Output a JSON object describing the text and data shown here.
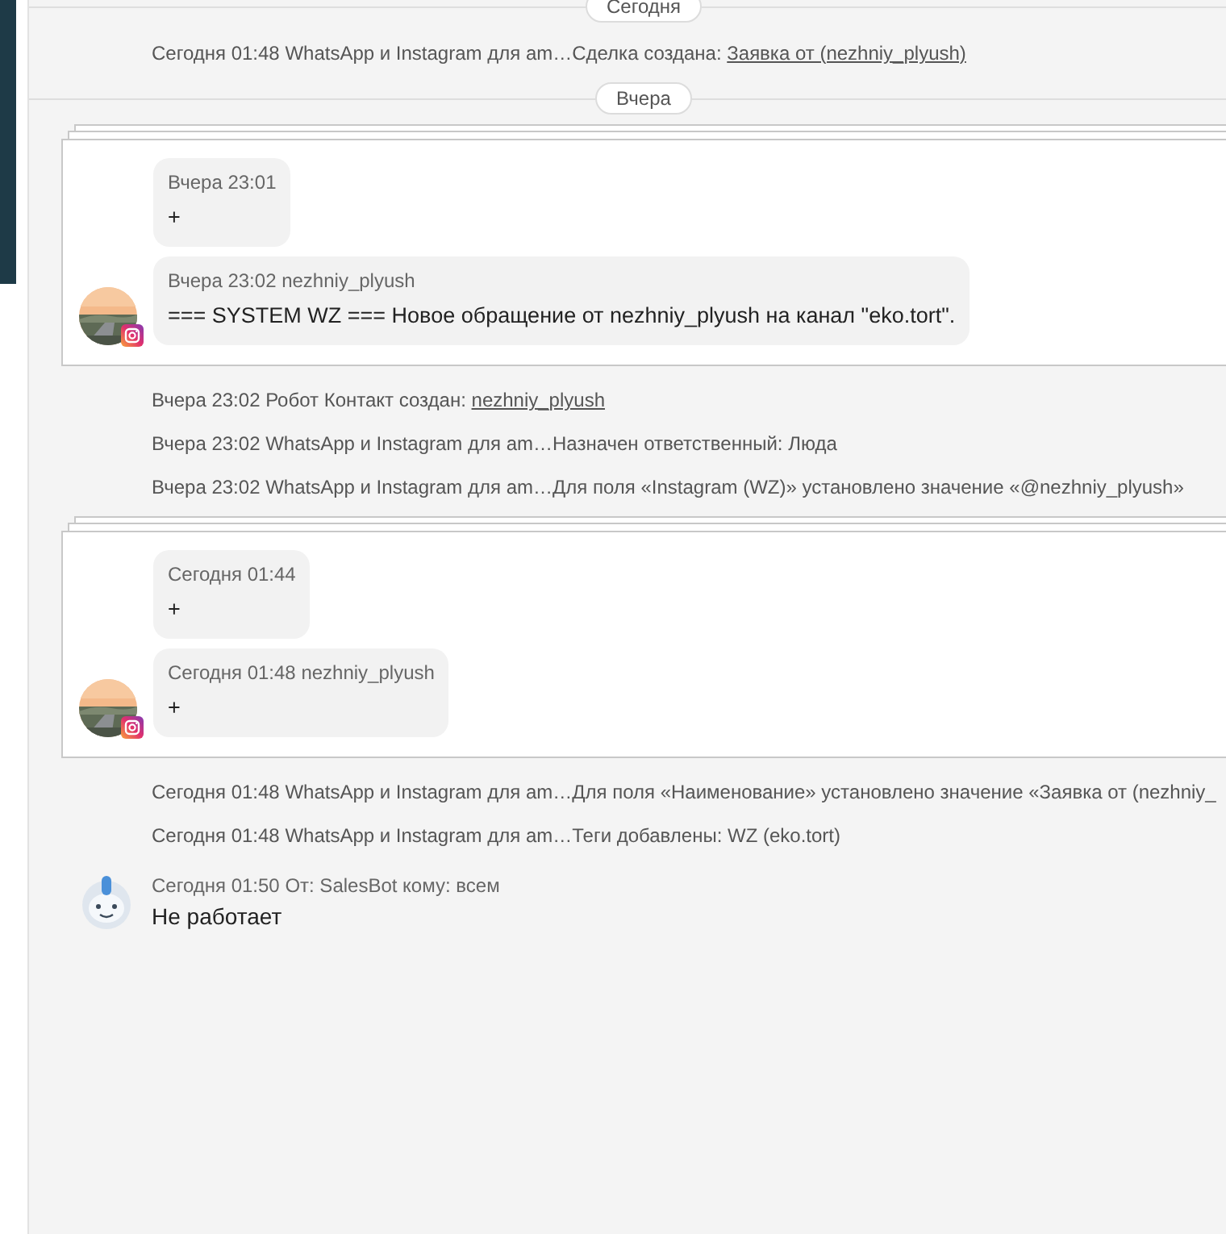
{
  "feed": [
    {
      "kind": "divider",
      "label": "Сегодня"
    },
    {
      "kind": "event",
      "time": "Сегодня 01:48",
      "source": "WhatsApp и Instagram для am…",
      "text": "Сделка создана: ",
      "link": "Заявка от (nezhniy_plyush)"
    },
    {
      "kind": "divider",
      "label": "Вчера"
    },
    {
      "kind": "chat",
      "messages": [
        {
          "header": "Вчера 23:01",
          "body": "+",
          "avatar": false
        },
        {
          "header": "Вчера 23:02 nezhniy_plyush",
          "body": "=== SYSTEM WZ === Новое обращение от nezhniy_plyush на канал \"eko.tort\".",
          "avatar": true
        }
      ]
    },
    {
      "kind": "event",
      "time": "Вчера 23:02",
      "source": "Робот ",
      "text": " Контакт создан: ",
      "link": "nezhniy_plyush"
    },
    {
      "kind": "event",
      "time": "Вчера 23:02",
      "source": "WhatsApp и Instagram для am…",
      "text": "Назначен ответственный: Люда"
    },
    {
      "kind": "event",
      "time": "Вчера 23:02",
      "source": "WhatsApp и Instagram для am…",
      "text": "Для поля «Instagram (WZ)» установлено значение «@nezhniy_plyush»"
    },
    {
      "kind": "chat",
      "messages": [
        {
          "header": "Сегодня 01:44",
          "body": "+",
          "avatar": false
        },
        {
          "header": "Сегодня 01:48 nezhniy_plyush",
          "body": "+",
          "avatar": true
        }
      ]
    },
    {
      "kind": "event",
      "time": "Сегодня 01:48",
      "source": "WhatsApp и Instagram для am…",
      "text": "Для поля «Наименование» установлено значение «Заявка от (nezhniy_"
    },
    {
      "kind": "event",
      "time": "Сегодня 01:48",
      "source": "WhatsApp и Instagram для am…",
      "text": "Теги добавлены: WZ (eko.tort)"
    },
    {
      "kind": "bot",
      "header": "Сегодня 01:50 От: SalesBot кому: всем",
      "body": "Не работает"
    }
  ]
}
